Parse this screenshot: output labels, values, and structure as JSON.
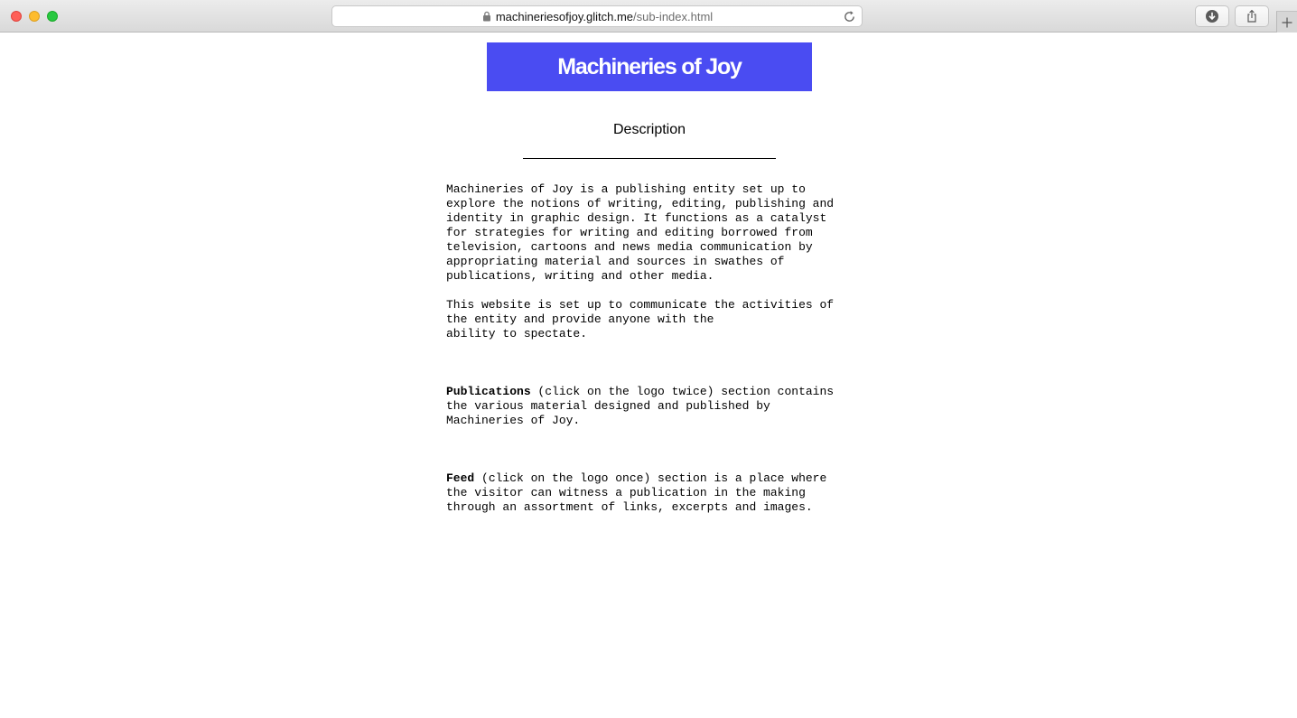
{
  "browser": {
    "url_host": "machineriesofjoy.glitch.me",
    "url_path": "/sub-index.html"
  },
  "page": {
    "logo_text": "Machineries of Joy",
    "section_title": "Description",
    "intro_paragraph": "Machineries of Joy is a publishing entity set up to\nexplore the notions of writing, editing, publishing and\nidentity in graphic design. It functions as a catalyst\nfor strategies for writing and editing borrowed from\ntelevision, cartoons and news media communication by\nappropriating material and sources in swathes of\npublications, writing and other media.",
    "website_paragraph": "This website is set up to communicate the activities of\nthe entity and provide anyone with the\nability to spectate.",
    "publications": {
      "label": "Publications",
      "text": " (click on the logo twice) section contains\nthe various material designed and published by\nMachineries of Joy."
    },
    "feed": {
      "label": "Feed",
      "text": " (click on the logo once) section is a place where\nthe visitor can witness a publication in the making\nthrough an assortment of links, excerpts and images."
    }
  },
  "colors": {
    "logo_background": "#4a4cf2",
    "logo_text": "#ffffff",
    "page_background": "#ffffff"
  }
}
